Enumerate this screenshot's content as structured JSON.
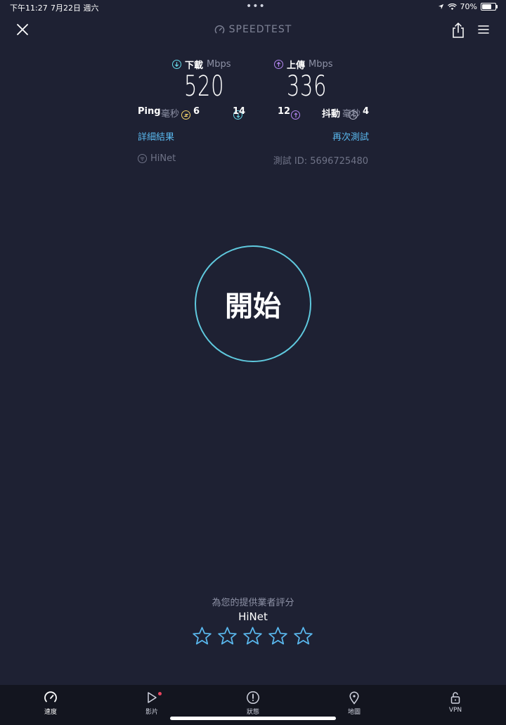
{
  "status_bar": {
    "time": "下午11:27",
    "date": "7月22日 週六",
    "battery": "70%",
    "battery_level": 0.7
  },
  "header": {
    "brand": "SPEEDTEST"
  },
  "results": {
    "download_label": "下載",
    "download_unit": "Mbps",
    "download_value": "520",
    "upload_label": "上傳",
    "upload_unit": "Mbps",
    "upload_value": "336",
    "ping_label": "Ping",
    "ping_unit": "毫秒",
    "ping_idle": "6",
    "ping_download": "14",
    "ping_upload": "12",
    "jitter_label": "抖動",
    "jitter_unit": "毫秒",
    "jitter_value": "4",
    "detail_link": "詳細結果",
    "retest_link": "再次測試",
    "isp": "HiNet",
    "test_id": "測試 ID: 5696725480"
  },
  "go_button": "開始",
  "rating": {
    "title": "為您的提供業者評分",
    "isp": "HiNet",
    "stars_total": 5,
    "stars_selected": 0
  },
  "tabs": [
    {
      "label": "速度",
      "icon": "speedometer-icon"
    },
    {
      "label": "影片",
      "icon": "play-icon"
    },
    {
      "label": "狀態",
      "icon": "alert-icon"
    },
    {
      "label": "地圖",
      "icon": "map-pin-icon"
    },
    {
      "label": "VPN",
      "icon": "lock-icon"
    }
  ],
  "colors": {
    "background": "#1e2133",
    "accent_cyan": "#5fc9de",
    "upload_purple": "#b486f2",
    "ping_yellow": "#f3d36b",
    "link_blue": "#5ab8ee"
  }
}
